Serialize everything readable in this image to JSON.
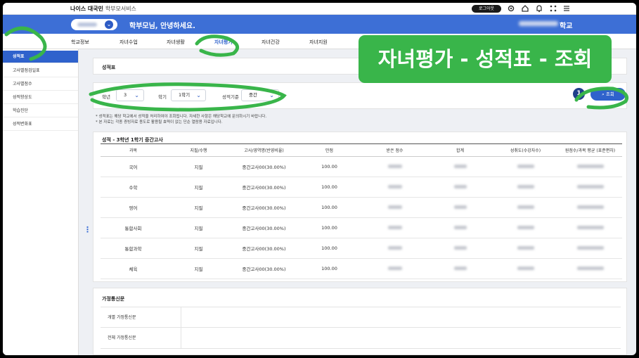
{
  "header": {
    "brand": "나이스 대국민",
    "service": "학부모서비스",
    "logout_label": "로그아웃",
    "icons": [
      "gear-icon",
      "home-icon",
      "bell-icon",
      "grid-icon",
      "menu-icon"
    ]
  },
  "banner": {
    "greeting": "학부모님, 안녕하세요.",
    "school_suffix": "학교"
  },
  "nav": [
    "학교정보",
    "자녀수업",
    "자녀생활",
    "자녀평가",
    "자녀건강",
    "자녀지원"
  ],
  "nav_active": "자녀평가",
  "sidebar": [
    {
      "label": "성적표",
      "active": true
    },
    {
      "label": "고사별점검일표",
      "active": false
    },
    {
      "label": "고사별점수",
      "active": false
    },
    {
      "label": "성적향상도",
      "active": false
    },
    {
      "label": "학습진단",
      "active": false
    },
    {
      "label": "성적변화표",
      "active": false
    }
  ],
  "page_title": "성적표",
  "filters": {
    "year_label": "학년",
    "year_value": "3",
    "term_label": "학기",
    "term_value": "1학기",
    "basis_label": "성적기준",
    "basis_value": "중간"
  },
  "step_badge": "1",
  "search_label": "조회",
  "notes": [
    "* 성적표는 해당 학교에서 성적을 처리하여야 조회됩니다. 자세한 사항은 해당학교에 문의하시기 바랍니다.",
    "* 본 자료는 각종 증빙자료 용도로 활용될 효력이 없는 단순 열람용 자료입니다."
  ],
  "grade_section": {
    "title": "성적 - 3학년 1학기 중간고사",
    "columns": [
      "과목",
      "지필/수행",
      "고사/영역명(반영비율)",
      "만점",
      "받은 점수",
      "합계",
      "성취도(수강자수)",
      "원점수/과목 평균 (표준편차)"
    ],
    "rows": [
      {
        "subject": "국어",
        "type": "지필",
        "exam": "중간고사00(30.00%)",
        "full": "100.00"
      },
      {
        "subject": "수학",
        "type": "지필",
        "exam": "중간고사00(30.00%)",
        "full": "100.00"
      },
      {
        "subject": "영어",
        "type": "지필",
        "exam": "중간고사00(30.00%)",
        "full": "100.00"
      },
      {
        "subject": "통합사회",
        "type": "지필",
        "exam": "중간고사00(30.00%)",
        "full": "100.00"
      },
      {
        "subject": "통합과학",
        "type": "지필",
        "exam": "중간고사00(30.00%)",
        "full": "100.00"
      },
      {
        "subject": "체육",
        "type": "지필",
        "exam": "중간고사00(30.00%)",
        "full": "100.00"
      }
    ]
  },
  "home_section": {
    "title": "가정통신문",
    "rows": [
      "개별 가정통신문",
      "전체 가정통신문"
    ]
  },
  "overlay_caption": "자녀평가 - 성적표 - 조회",
  "colors": {
    "primary": "#3d6fd6",
    "accent": "#2f62cc",
    "overlay": "#39b54a",
    "badge": "#1f3f8a"
  }
}
